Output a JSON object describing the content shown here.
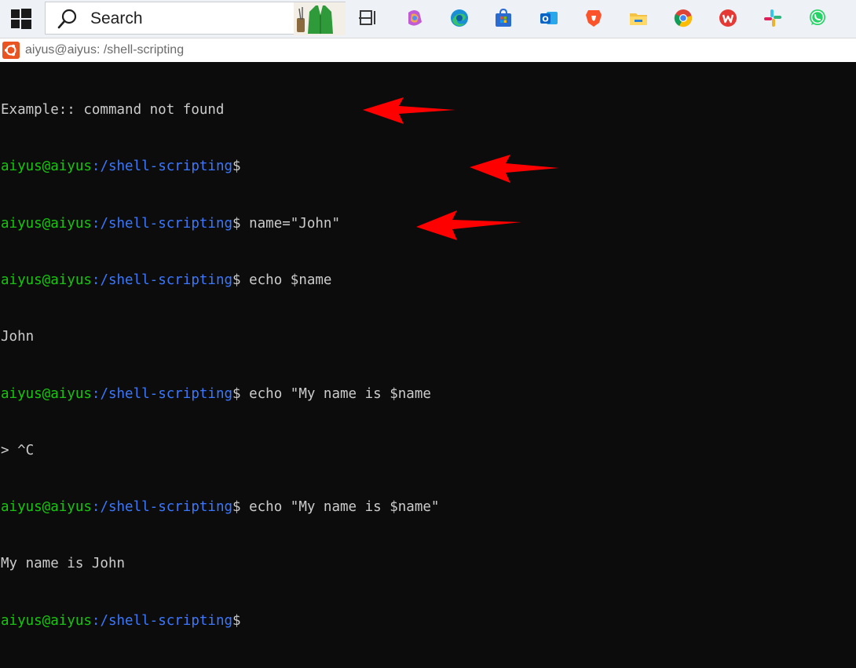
{
  "taskbar": {
    "search_placeholder": "Search",
    "pinned_apps": [
      {
        "name": "task-view",
        "color": "#3a3a3a"
      },
      {
        "name": "copilot",
        "color": "#c05ad6"
      },
      {
        "name": "edge",
        "color": "#1a8fd6"
      },
      {
        "name": "microsoft-store",
        "color": "#2a6bd1"
      },
      {
        "name": "outlook",
        "color": "#0a64c4"
      },
      {
        "name": "brave",
        "color": "#fb542b"
      },
      {
        "name": "file-explorer",
        "color": "#f5c343"
      },
      {
        "name": "chrome",
        "color": "#4285f4"
      },
      {
        "name": "wps-office",
        "color": "#e53935"
      },
      {
        "name": "slack",
        "color": "#4a154b"
      },
      {
        "name": "whatsapp",
        "color": "#25d366"
      }
    ]
  },
  "window": {
    "title": "aiyus@aiyus: /shell-scripting"
  },
  "terminal": {
    "colors": {
      "user": "#16c60c",
      "path": "#3b78ff",
      "text": "#cccccc",
      "annotation_arrow": "#ff0000"
    },
    "prompt_user": "aiyus@aiyus",
    "prompt_path": ":/shell-scripting",
    "lines": [
      {
        "type": "output",
        "text": "Example:: command not found"
      },
      {
        "type": "prompt",
        "user": "aiyus@aiyus",
        "path": ":/shell-scripting",
        "dollar": "$",
        "command": ""
      },
      {
        "type": "prompt",
        "user": "aiyus@aiyus",
        "path": ":/shell-scripting",
        "dollar": "$",
        "command": " name=\"John\""
      },
      {
        "type": "prompt",
        "user": "aiyus@aiyus",
        "path": ":/shell-scripting",
        "dollar": "$",
        "command": " echo $name"
      },
      {
        "type": "output",
        "text": "John"
      },
      {
        "type": "prompt",
        "user": "aiyus@aiyus",
        "path": ":/shell-scripting",
        "dollar": "$",
        "command": " echo \"My name is $name"
      },
      {
        "type": "output",
        "text": "> ^C"
      },
      {
        "type": "prompt",
        "user": "aiyus@aiyus",
        "path": ":/shell-scripting",
        "dollar": "$",
        "command": " echo \"My name is $name\""
      },
      {
        "type": "output",
        "text": "My name is John"
      },
      {
        "type": "prompt",
        "user": "aiyus@aiyus",
        "path": ":/shell-scripting",
        "dollar": "$",
        "command": ""
      }
    ]
  }
}
